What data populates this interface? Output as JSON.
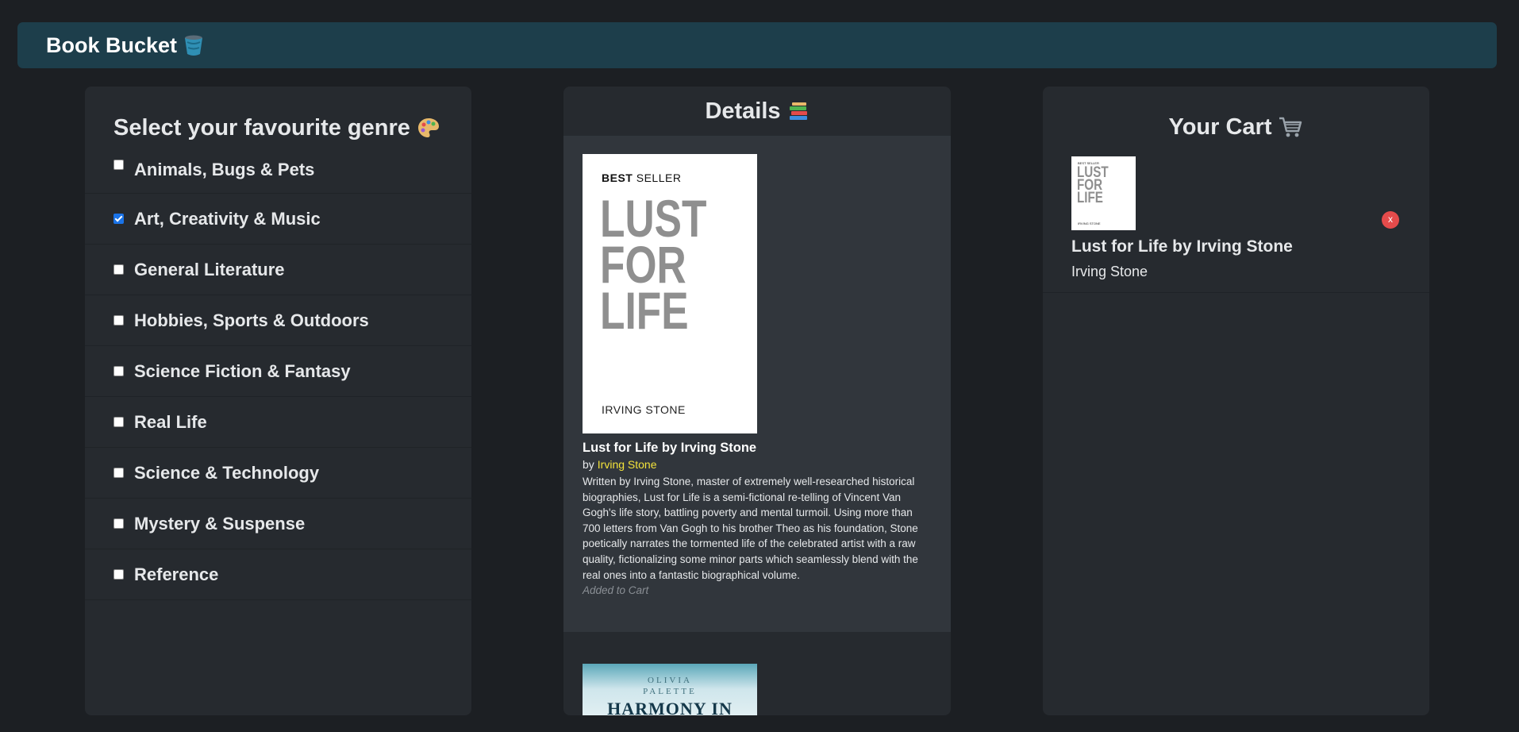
{
  "header": {
    "brand": "Book Bucket",
    "brand_icon": "bucket-icon"
  },
  "genres": {
    "title": "Select your favourite genre",
    "title_icon": "palette-icon",
    "items": [
      {
        "label": "Animals, Bugs & Pets",
        "checked": false
      },
      {
        "label": "Art, Creativity & Music",
        "checked": true
      },
      {
        "label": "General Literature",
        "checked": false
      },
      {
        "label": "Hobbies, Sports & Outdoors",
        "checked": false
      },
      {
        "label": "Science Fiction & Fantasy",
        "checked": false
      },
      {
        "label": "Real Life",
        "checked": false
      },
      {
        "label": "Science & Technology",
        "checked": false
      },
      {
        "label": "Mystery & Suspense",
        "checked": false
      },
      {
        "label": "Reference",
        "checked": false
      }
    ]
  },
  "details": {
    "title": "Details",
    "title_icon": "books-icon",
    "book": {
      "cover": {
        "badge_bold": "BEST",
        "badge_rest": "SELLER",
        "line1": "LUST",
        "line2": "FOR",
        "line3": "LIFE",
        "author": "IRVING STONE"
      },
      "title": "Lust for Life by Irving Stone",
      "by": "by",
      "author": "Irving Stone",
      "description": "Written by Irving Stone, master of extremely well-researched historical biographies, Lust for Life is a semi-fictional re-telling of Vincent Van Gogh's life story, battling poverty and mental turmoil. Using more than 700 letters from Van Gogh to his brother Theo as his foundation, Stone poetically narrates the tormented life of the celebrated artist with a raw quality, fictionalizing some minor parts which seamlessly blend with the real ones into a fantastic biographical volume.",
      "status": "Added to Cart"
    },
    "next_book": {
      "cover_author_line1": "OLIVIA",
      "cover_author_line2": "PALETTE",
      "cover_title": "HARMONY IN"
    }
  },
  "cart": {
    "title": "Your Cart",
    "title_icon": "shopping-cart-icon",
    "items": [
      {
        "title": "Lust for Life by Irving Stone",
        "author": "Irving Stone",
        "remove_label": "x",
        "thumb": {
          "badge": "BEST SELLER",
          "line1": "LUST",
          "line2": "FOR",
          "line3": "LIFE",
          "author": "IRVING STONE"
        }
      }
    ]
  },
  "colors": {
    "background": "#1c1f23",
    "topbar": "#1d3e4b",
    "panel": "#262a2f",
    "card": "#31363c",
    "author_link": "#f3e33b",
    "remove": "#e54b4b",
    "checkbox_checked": "#1a73e8"
  }
}
